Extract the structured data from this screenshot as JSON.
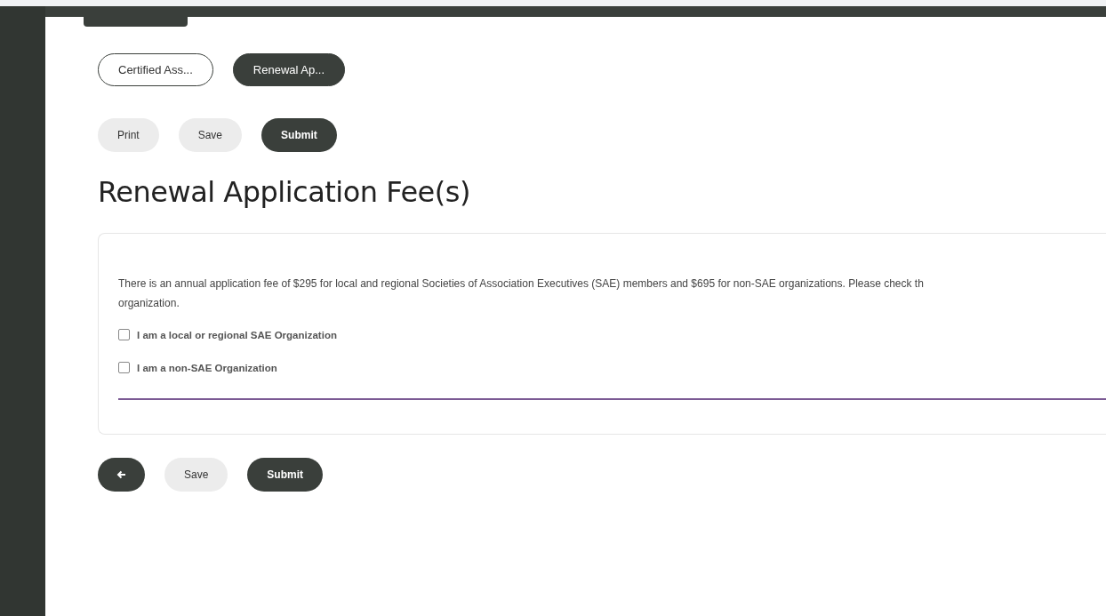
{
  "tabs": [
    {
      "label": "Certified Ass...",
      "selected": false
    },
    {
      "label": "Renewal Ap...",
      "selected": true
    }
  ],
  "top_actions": [
    {
      "label": "Print",
      "kind": "light"
    },
    {
      "label": "Save",
      "kind": "light"
    },
    {
      "label": "Submit",
      "kind": "dark"
    }
  ],
  "heading": "Renewal Application Fee(s)",
  "card": {
    "paragraph_lines": [
      "There is an annual application fee of $295 for local and regional Societies of Association Executives (SAE) members and $695 for non-SAE organizations. Please check th",
      "organization."
    ],
    "options": [
      {
        "label": "I am a local or regional SAE Organization",
        "checked": false
      },
      {
        "label": "I am a non-SAE Organization",
        "checked": false
      }
    ]
  },
  "bottom_actions": [
    {
      "kind": "back"
    },
    {
      "label": "Save",
      "kind": "light"
    },
    {
      "label": "Submit",
      "kind": "dark"
    }
  ]
}
